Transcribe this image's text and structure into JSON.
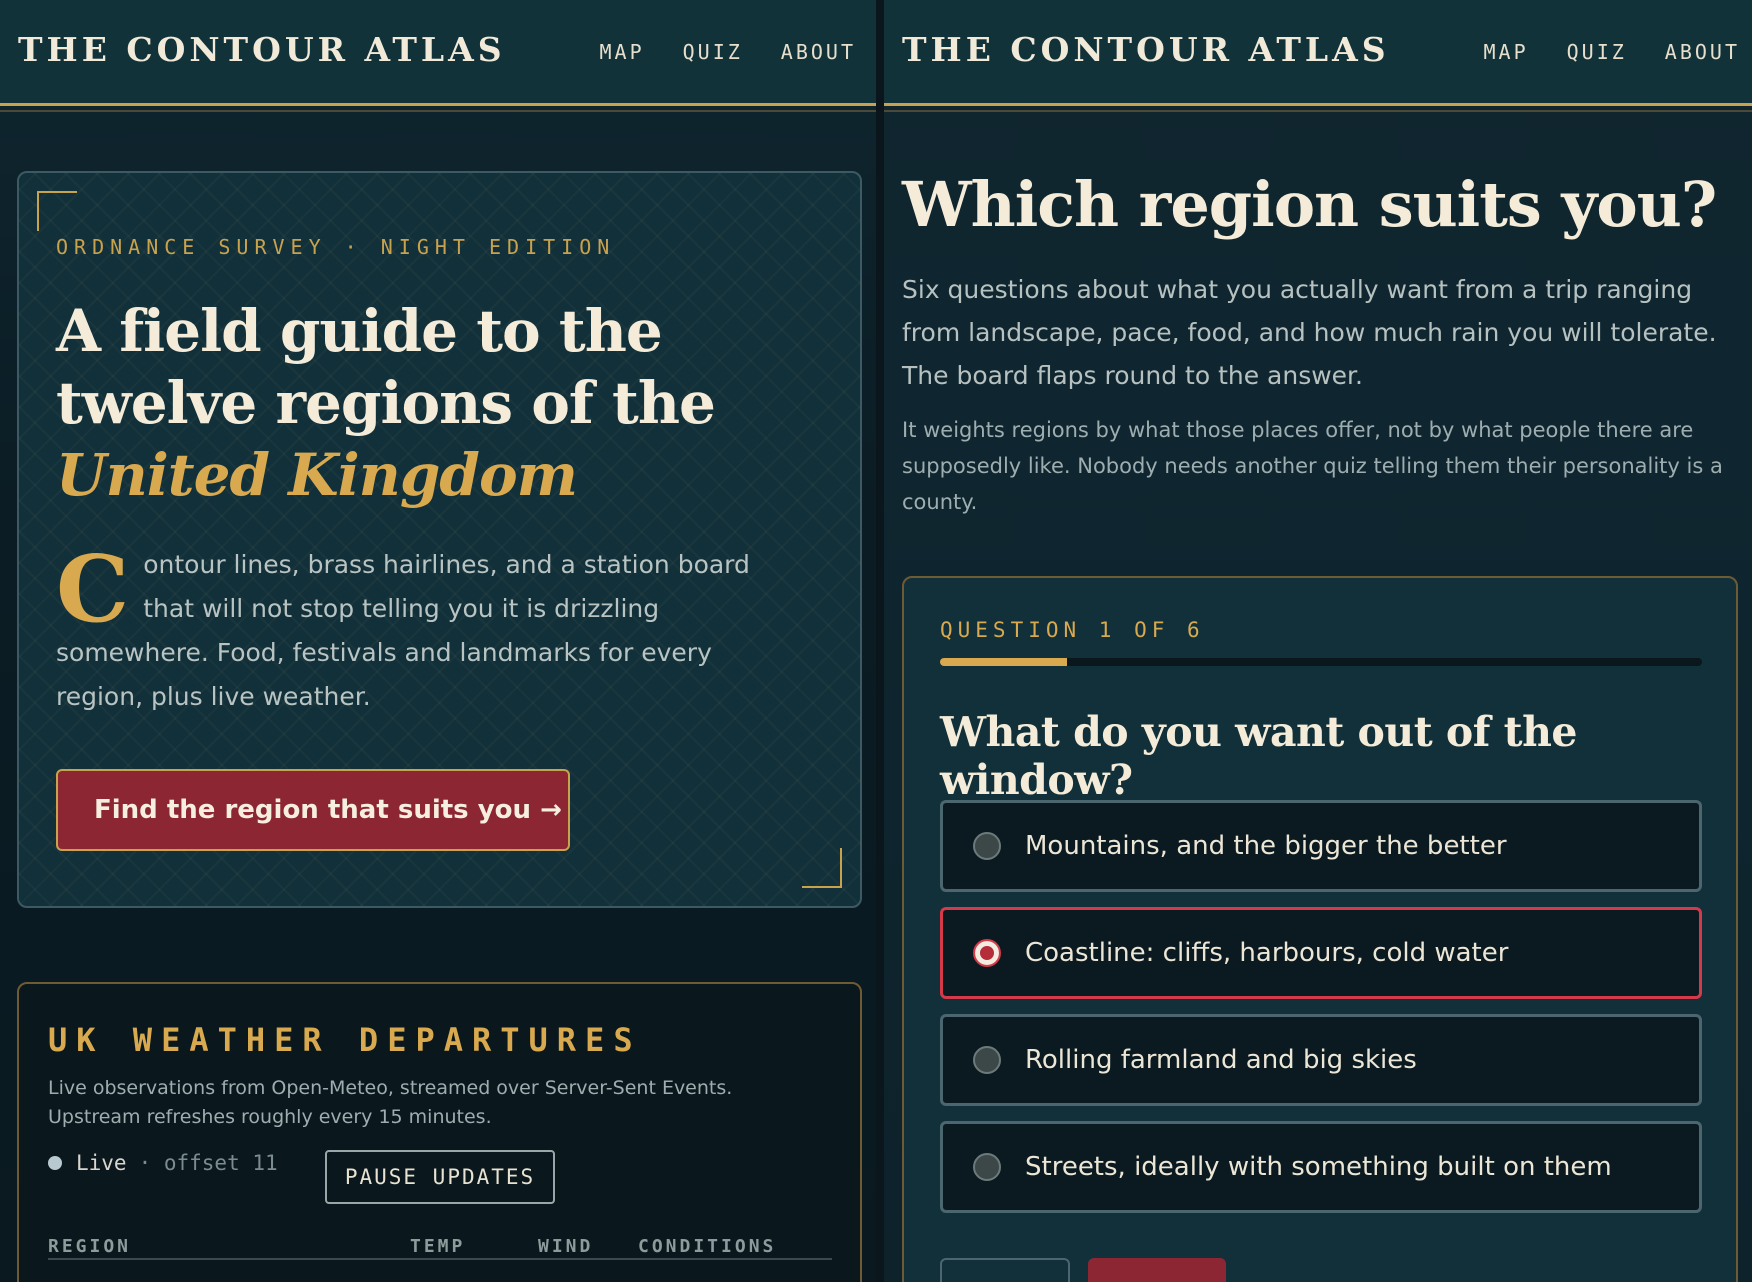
{
  "left": {
    "header": {
      "brand": "THE CONTOUR ATLAS",
      "nav": [
        "MAP",
        "QUIZ",
        "ABOUT"
      ]
    },
    "hero": {
      "eyebrow": "ORDNANCE SURVEY · NIGHT EDITION",
      "title_plain": "A field guide to the twelve regions of the ",
      "title_accent": "United Kingdom",
      "dropcap": "C",
      "body": "ontour lines, brass hairlines, and a station board that will not stop telling you it is drizzling somewhere. Food, festivals and landmarks for every region, plus live weather.",
      "cta_label": "Find the region that suits you →"
    },
    "weather": {
      "title": "UK WEATHER DEPARTURES",
      "description": "Live observations from Open-Meteo, streamed over Server-Sent Events. Upstream refreshes roughly every 15 minutes.",
      "status": "Live",
      "offset": "· offset 11",
      "pause_label": "PAUSE UPDATES",
      "columns": [
        "REGION",
        "TEMP",
        "WIND",
        "CONDITIONS"
      ]
    }
  },
  "right": {
    "header": {
      "brand": "THE CONTOUR ATLAS",
      "nav": [
        "MAP",
        "QUIZ",
        "ABOUT"
      ]
    },
    "title": "Which region suits you?",
    "lead": "Six questions about what you actually want from a trip ranging from landscape, pace, food, and how much rain you will tolerate. The board flaps round to the answer.",
    "note": "It weights regions by what those places offer, not by what people there are supposedly like. Nobody needs another quiz telling them their personality is a county.",
    "quiz": {
      "progress_label": "QUESTION 1 OF 6",
      "progress_fraction": 0.1667,
      "question": "What do you want out of the window?",
      "selected_index": 1,
      "options": [
        "Mountains, and the bigger the better",
        "Coastline: cliffs, harbours, cold water",
        "Rolling farmland and big skies",
        "Streets, ideally with something built on them"
      ]
    }
  },
  "colors": {
    "brass": "#c9a24e",
    "accent_red": "#8d2633",
    "selected_border": "#d43a4a",
    "background": "#0f2630"
  }
}
